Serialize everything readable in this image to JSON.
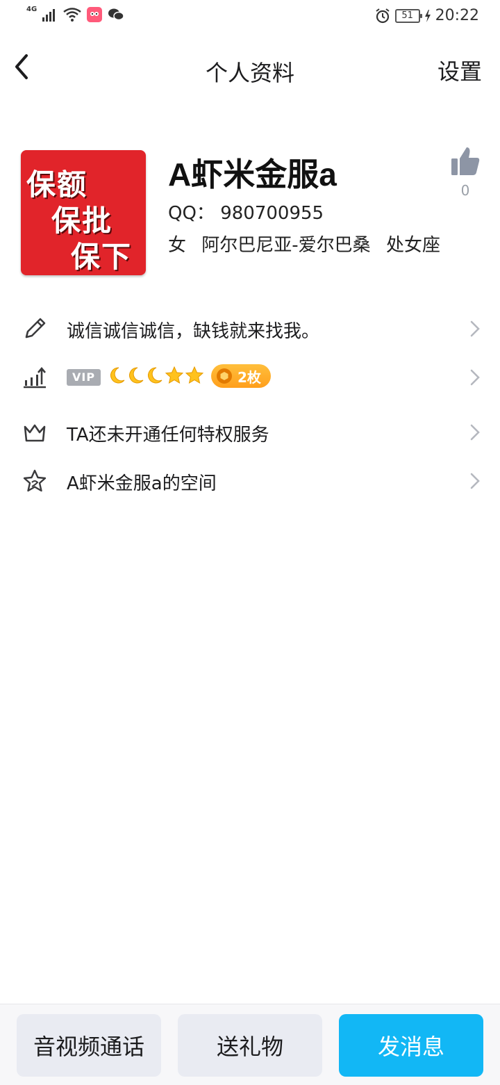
{
  "status_bar": {
    "network": "4G",
    "battery": "51",
    "time": "20:22"
  },
  "nav": {
    "title": "个人资料",
    "settings_label": "设置"
  },
  "profile": {
    "avatar_text": [
      "保额",
      "保批",
      "保下"
    ],
    "nickname": "A虾米金服a",
    "qq": "QQ：  980700955",
    "gender": "女",
    "location": "阿尔巴尼亚-爱尔巴桑",
    "zodiac": "处女座",
    "likes": "0"
  },
  "rows": {
    "signature": "诚信诚信诚信，缺钱就来找我。",
    "vip_label": "VIP",
    "level_icons": [
      "moon",
      "moon",
      "moon",
      "star",
      "star"
    ],
    "coin_label": "2枚",
    "privilege": "TA还未开通任何特权服务",
    "space": "A虾米金服a的空间"
  },
  "bottom": {
    "call_label": "音视频通话",
    "gift_label": "送礼物",
    "message_label": "发消息"
  },
  "colors": {
    "primary": "#12b7f5",
    "avatar_bg": "#e1242a",
    "coin_pill": "#ffaa2a"
  }
}
